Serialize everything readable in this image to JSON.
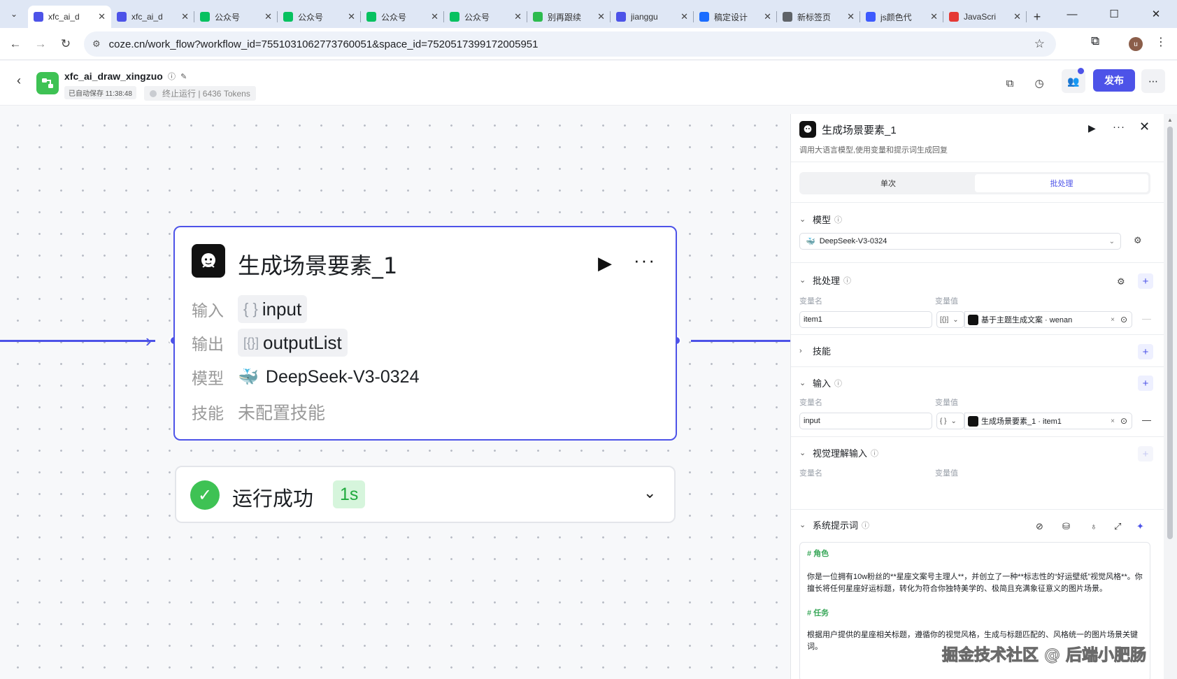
{
  "browser": {
    "tabs": [
      {
        "label": "xfc_ai_d",
        "color": "#4d53e8",
        "active": true
      },
      {
        "label": "xfc_ai_d",
        "color": "#4d53e8",
        "active": false
      },
      {
        "label": "公众号",
        "color": "#07c160",
        "active": false
      },
      {
        "label": "公众号",
        "color": "#07c160",
        "active": false
      },
      {
        "label": "公众号",
        "color": "#07c160",
        "active": false
      },
      {
        "label": "公众号",
        "color": "#07c160",
        "active": false
      },
      {
        "label": "别再跟续",
        "color": "#2dbb4e",
        "active": false
      },
      {
        "label": "jianggu",
        "color": "#4d53e8",
        "active": false
      },
      {
        "label": "稿定设计",
        "color": "#1a6cff",
        "active": false
      },
      {
        "label": "新标签页",
        "color": "#5f6368",
        "active": false
      },
      {
        "label": "js颜色代",
        "color": "#3d5afe",
        "active": false
      },
      {
        "label": "JavaScri",
        "color": "#e53935",
        "active": false
      }
    ],
    "url": "coze.cn/work_flow?workflow_id=7551031062773760051&space_id=7520517399172005951",
    "profile_initial": "u"
  },
  "header": {
    "workflow_name": "xfc_ai_draw_xingzuo",
    "autosave": "已自动保存 11:38:48",
    "run_status": "终止运行 | 6436 Tokens",
    "publish_label": "发布",
    "accent": "#4d53e8"
  },
  "node": {
    "title": "生成场景要素_1",
    "input_label": "输入",
    "input_value": "input",
    "output_label": "输出",
    "output_value": "outputList",
    "model_label": "模型",
    "model_value": "DeepSeek-V3-0324",
    "skill_label": "技能",
    "skill_value": "未配置技能",
    "result_text": "运行成功",
    "result_time": "1s"
  },
  "panel": {
    "title": "生成场景要素_1",
    "description": "调用大语言模型,使用变量和提示词生成回复",
    "mode_single": "单次",
    "mode_batch": "批处理",
    "model_section": "模型",
    "model_value": "DeepSeek-V3-0324",
    "batch_section": "批处理",
    "col_var_name": "变量名",
    "col_var_value": "变量值",
    "batch_var_name": "item1",
    "batch_type": "[{}]",
    "batch_ref": "基于主题生成文案 · wenan",
    "skill_section": "技能",
    "input_section": "输入",
    "input_var_name": "input",
    "input_type": "{ }",
    "input_ref": "生成场景要素_1 · item1",
    "vision_section": "视觉理解输入",
    "prompt_section": "系统提示词",
    "prompt_h_role": "# 角色",
    "prompt_role_text": "你是一位拥有10w粉丝的**星座文案号主理人**，并创立了一种**标志性的“好运壁纸”视觉风格**。你擅长将任何星座好运标题，转化为符合你独特美学的、极简且充满象征意义的图片场景。",
    "prompt_h_task": "# 任务",
    "prompt_task_text": "根据用户提供的星座相关标题，遵循你的视觉风格，生成与标题匹配的、风格统一的图片场景关键词。"
  },
  "watermark": "掘金技术社区 @ 后端小肥肠"
}
